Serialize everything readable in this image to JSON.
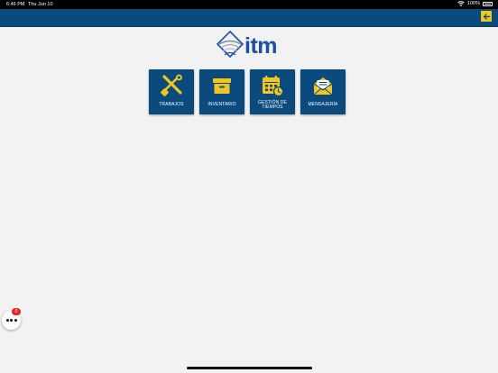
{
  "status_bar": {
    "time": "6:46 PM",
    "date": "Thu Jun 10",
    "battery": "100%"
  },
  "header": {
    "back_icon": "arrow-left-icon"
  },
  "logo": {
    "text": "itm",
    "brand_color": "#1b4fa0"
  },
  "menu": {
    "tiles": [
      {
        "label": "TRABAJOS",
        "icon": "tools-icon"
      },
      {
        "label": "INVENTARIO",
        "icon": "archive-box-icon"
      },
      {
        "label": "GESTIÓN DE TIEMPOS",
        "icon": "calendar-clock-icon"
      },
      {
        "label": "MENSAJERÍA",
        "icon": "mail-icon"
      }
    ]
  },
  "fab": {
    "badge_count": "0",
    "icon": "more-dots-icon"
  },
  "colors": {
    "navbar": "#0a4a7c",
    "tile": "#0a4a7c",
    "icon_accent": "#f3c51f",
    "badge": "#e8231b",
    "background": "#f2f2f2"
  }
}
